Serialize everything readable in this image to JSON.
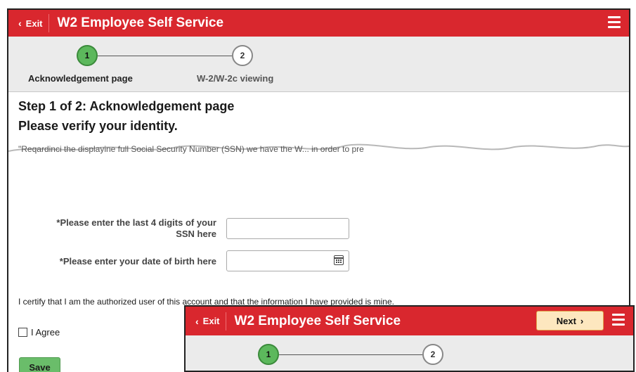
{
  "header": {
    "exit_label": "Exit",
    "title": "W2 Employee Self Service"
  },
  "steps": [
    {
      "number": "1",
      "label": "Acknowledgement page"
    },
    {
      "number": "2",
      "label": "W-2/W-2c viewing"
    }
  ],
  "content": {
    "step_heading": "Step 1 of 2: Acknowledgement page",
    "verify_heading": "Please verify your identity.",
    "torn_text": "\"Reqardinci the displayine full Social Security Number (SSN) we have the W... in order to pre"
  },
  "form": {
    "ssn_label_line1": "*Please enter the last 4 digits of your",
    "ssn_label_line2": "SSN here",
    "ssn_value": "",
    "dob_label": "*Please enter your date of birth here",
    "dob_value": ""
  },
  "certify_text": "I certify that I am the authorized user of this account and that the information I have provided is mine.",
  "agree_label": "I Agree",
  "save_label": "Save",
  "overlay": {
    "exit_label": "Exit",
    "title": "W2 Employee Self Service",
    "next_label": "Next",
    "steps": [
      {
        "number": "1"
      },
      {
        "number": "2"
      }
    ]
  }
}
